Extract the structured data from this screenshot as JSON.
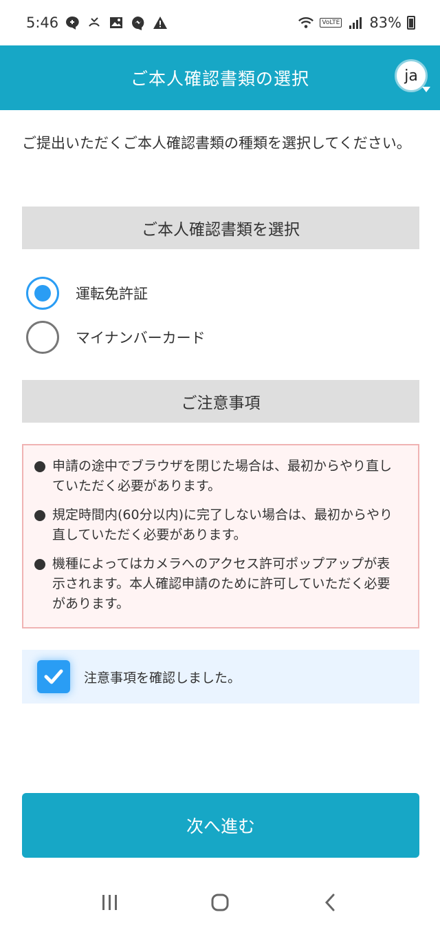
{
  "status_bar": {
    "time": "5:46",
    "battery": "83%",
    "network_badge": "VoLTE",
    "left_icons": [
      "chat-icon",
      "missed-call-icon",
      "image-icon",
      "messenger-icon",
      "warning-icon"
    ],
    "right_icons": [
      "wifi-icon",
      "volte-icon",
      "signal-icon",
      "battery-icon"
    ]
  },
  "header": {
    "title": "ご本人確認書類の選択",
    "language_label": "ja",
    "color": "#17a7c6"
  },
  "intro_text": "ご提出いただくご本人確認書類の種類を選択してください。",
  "document_section": {
    "heading": "ご本人確認書類を選択",
    "options": [
      {
        "label": "運転免許証",
        "selected": true
      },
      {
        "label": "マイナンバーカード",
        "selected": false
      }
    ]
  },
  "notice_section": {
    "heading": "ご注意事項",
    "items": [
      "申請の途中でブラウザを閉じた場合は、最初からやり直していただく必要があります。",
      "規定時間内(60分以内)に完了しない場合は、最初からやり直していただく必要があります。",
      "機種によってはカメラへのアクセス許可ポップアップが表示されます。本人確認申請のために許可していただく必要があります。"
    ]
  },
  "confirm": {
    "label": "注意事項を確認しました。",
    "checked": true
  },
  "next_button": {
    "label": "次へ進む"
  },
  "nav_bar": {
    "icons": [
      "recent-apps-icon",
      "home-icon",
      "back-icon"
    ]
  },
  "colors": {
    "accent": "#17a7c6",
    "radio_selected": "#2a9df4",
    "notice_bg": "#fff4f4",
    "notice_border": "#f0b3b3",
    "confirm_bg": "#eaf4ff",
    "section_bg": "#dedede"
  }
}
